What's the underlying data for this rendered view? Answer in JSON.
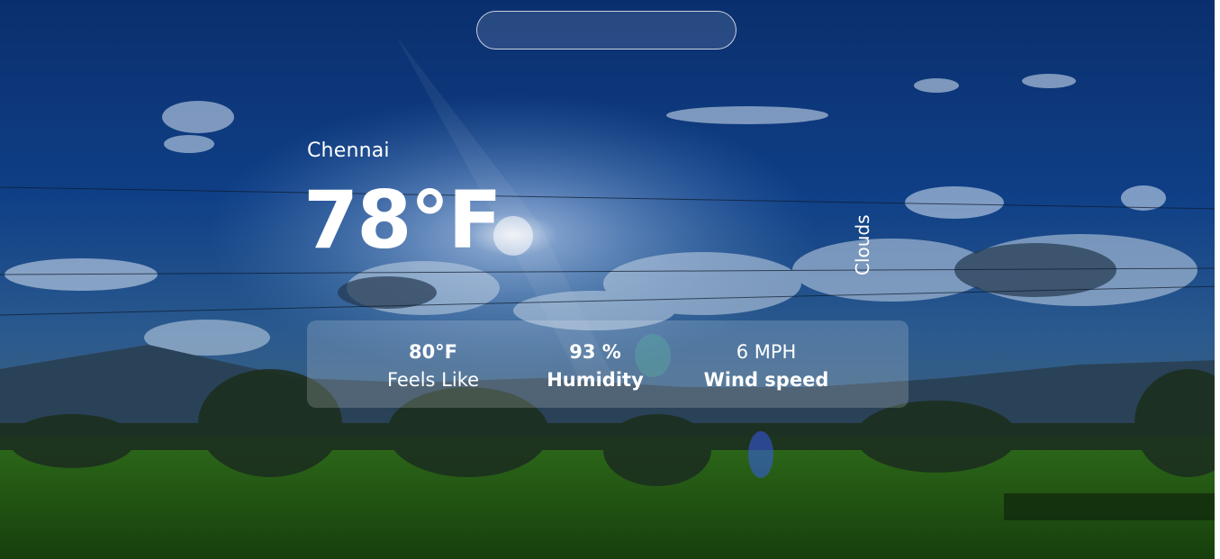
{
  "search": {
    "placeholder": "",
    "value": ""
  },
  "weather": {
    "city": "Chennai",
    "temperature": "78°F",
    "condition": "Clouds"
  },
  "details": {
    "feels_like": {
      "value": "80°F",
      "label": "Feels Like"
    },
    "humidity": {
      "value": "93 %",
      "label": "Humidity"
    },
    "wind": {
      "value": "6 MPH",
      "label": "Wind speed"
    }
  }
}
